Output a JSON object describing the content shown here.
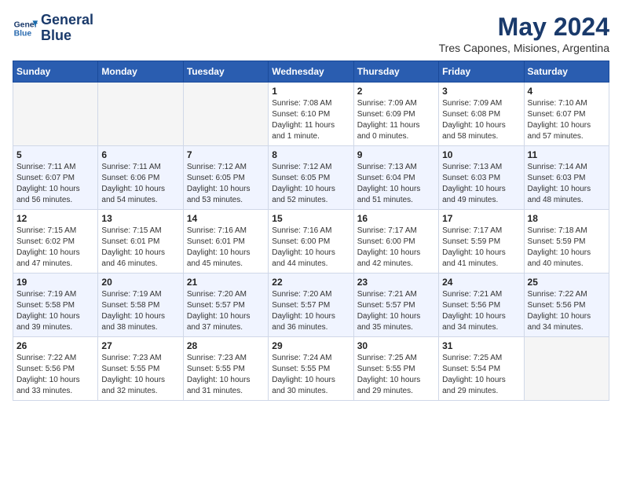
{
  "header": {
    "logo_line1": "General",
    "logo_line2": "Blue",
    "title": "May 2024",
    "subtitle": "Tres Capones, Misiones, Argentina"
  },
  "days_of_week": [
    "Sunday",
    "Monday",
    "Tuesday",
    "Wednesday",
    "Thursday",
    "Friday",
    "Saturday"
  ],
  "weeks": [
    [
      {
        "date": "",
        "info": ""
      },
      {
        "date": "",
        "info": ""
      },
      {
        "date": "",
        "info": ""
      },
      {
        "date": "1",
        "info": "Sunrise: 7:08 AM\nSunset: 6:10 PM\nDaylight: 11 hours\nand 1 minute."
      },
      {
        "date": "2",
        "info": "Sunrise: 7:09 AM\nSunset: 6:09 PM\nDaylight: 11 hours\nand 0 minutes."
      },
      {
        "date": "3",
        "info": "Sunrise: 7:09 AM\nSunset: 6:08 PM\nDaylight: 10 hours\nand 58 minutes."
      },
      {
        "date": "4",
        "info": "Sunrise: 7:10 AM\nSunset: 6:07 PM\nDaylight: 10 hours\nand 57 minutes."
      }
    ],
    [
      {
        "date": "5",
        "info": "Sunrise: 7:11 AM\nSunset: 6:07 PM\nDaylight: 10 hours\nand 56 minutes."
      },
      {
        "date": "6",
        "info": "Sunrise: 7:11 AM\nSunset: 6:06 PM\nDaylight: 10 hours\nand 54 minutes."
      },
      {
        "date": "7",
        "info": "Sunrise: 7:12 AM\nSunset: 6:05 PM\nDaylight: 10 hours\nand 53 minutes."
      },
      {
        "date": "8",
        "info": "Sunrise: 7:12 AM\nSunset: 6:05 PM\nDaylight: 10 hours\nand 52 minutes."
      },
      {
        "date": "9",
        "info": "Sunrise: 7:13 AM\nSunset: 6:04 PM\nDaylight: 10 hours\nand 51 minutes."
      },
      {
        "date": "10",
        "info": "Sunrise: 7:13 AM\nSunset: 6:03 PM\nDaylight: 10 hours\nand 49 minutes."
      },
      {
        "date": "11",
        "info": "Sunrise: 7:14 AM\nSunset: 6:03 PM\nDaylight: 10 hours\nand 48 minutes."
      }
    ],
    [
      {
        "date": "12",
        "info": "Sunrise: 7:15 AM\nSunset: 6:02 PM\nDaylight: 10 hours\nand 47 minutes."
      },
      {
        "date": "13",
        "info": "Sunrise: 7:15 AM\nSunset: 6:01 PM\nDaylight: 10 hours\nand 46 minutes."
      },
      {
        "date": "14",
        "info": "Sunrise: 7:16 AM\nSunset: 6:01 PM\nDaylight: 10 hours\nand 45 minutes."
      },
      {
        "date": "15",
        "info": "Sunrise: 7:16 AM\nSunset: 6:00 PM\nDaylight: 10 hours\nand 44 minutes."
      },
      {
        "date": "16",
        "info": "Sunrise: 7:17 AM\nSunset: 6:00 PM\nDaylight: 10 hours\nand 42 minutes."
      },
      {
        "date": "17",
        "info": "Sunrise: 7:17 AM\nSunset: 5:59 PM\nDaylight: 10 hours\nand 41 minutes."
      },
      {
        "date": "18",
        "info": "Sunrise: 7:18 AM\nSunset: 5:59 PM\nDaylight: 10 hours\nand 40 minutes."
      }
    ],
    [
      {
        "date": "19",
        "info": "Sunrise: 7:19 AM\nSunset: 5:58 PM\nDaylight: 10 hours\nand 39 minutes."
      },
      {
        "date": "20",
        "info": "Sunrise: 7:19 AM\nSunset: 5:58 PM\nDaylight: 10 hours\nand 38 minutes."
      },
      {
        "date": "21",
        "info": "Sunrise: 7:20 AM\nSunset: 5:57 PM\nDaylight: 10 hours\nand 37 minutes."
      },
      {
        "date": "22",
        "info": "Sunrise: 7:20 AM\nSunset: 5:57 PM\nDaylight: 10 hours\nand 36 minutes."
      },
      {
        "date": "23",
        "info": "Sunrise: 7:21 AM\nSunset: 5:57 PM\nDaylight: 10 hours\nand 35 minutes."
      },
      {
        "date": "24",
        "info": "Sunrise: 7:21 AM\nSunset: 5:56 PM\nDaylight: 10 hours\nand 34 minutes."
      },
      {
        "date": "25",
        "info": "Sunrise: 7:22 AM\nSunset: 5:56 PM\nDaylight: 10 hours\nand 34 minutes."
      }
    ],
    [
      {
        "date": "26",
        "info": "Sunrise: 7:22 AM\nSunset: 5:56 PM\nDaylight: 10 hours\nand 33 minutes."
      },
      {
        "date": "27",
        "info": "Sunrise: 7:23 AM\nSunset: 5:55 PM\nDaylight: 10 hours\nand 32 minutes."
      },
      {
        "date": "28",
        "info": "Sunrise: 7:23 AM\nSunset: 5:55 PM\nDaylight: 10 hours\nand 31 minutes."
      },
      {
        "date": "29",
        "info": "Sunrise: 7:24 AM\nSunset: 5:55 PM\nDaylight: 10 hours\nand 30 minutes."
      },
      {
        "date": "30",
        "info": "Sunrise: 7:25 AM\nSunset: 5:55 PM\nDaylight: 10 hours\nand 29 minutes."
      },
      {
        "date": "31",
        "info": "Sunrise: 7:25 AM\nSunset: 5:54 PM\nDaylight: 10 hours\nand 29 minutes."
      },
      {
        "date": "",
        "info": ""
      }
    ]
  ]
}
